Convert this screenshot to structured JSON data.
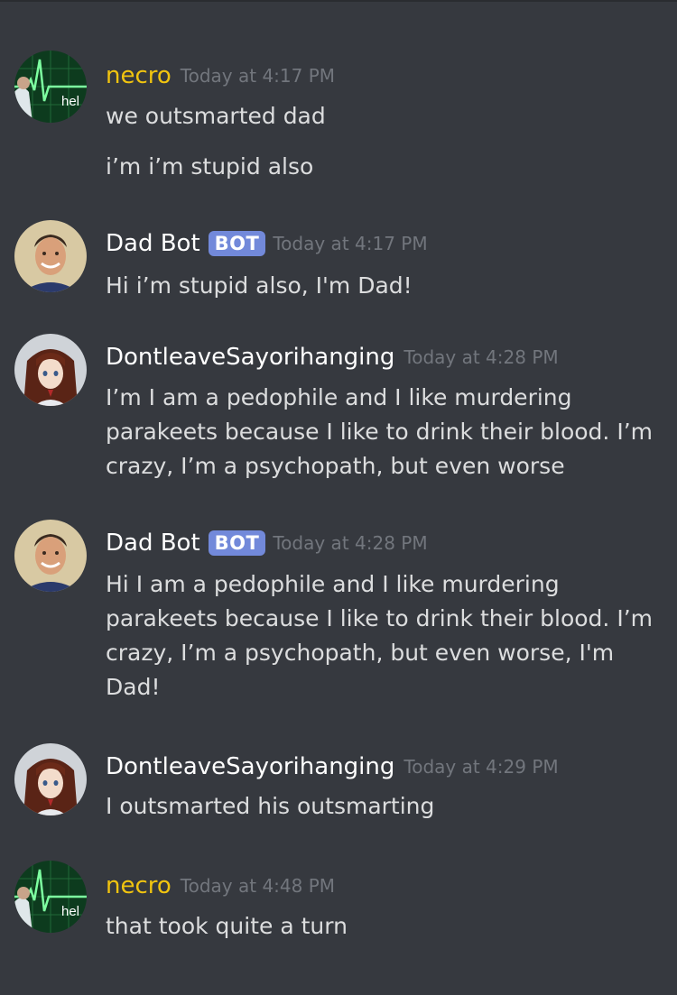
{
  "messages": [
    {
      "author": "necro",
      "author_color": "#f1c40f",
      "bot": false,
      "avatar_icon": "heartbeat-avatar-icon",
      "avatar_text": "hel",
      "timestamp": "Today at 4:17 PM",
      "lines": [
        "we outsmarted dad",
        "i’m i’m stupid also"
      ]
    },
    {
      "author": "Dad Bot",
      "author_color": "#ffffff",
      "bot": true,
      "badge": "BOT",
      "avatar_icon": "smiling-man-avatar-icon",
      "timestamp": "Today at 4:17 PM",
      "lines": [
        "Hi i’m stupid also, I'm Dad!"
      ]
    },
    {
      "author": "DontleaveSayorihanging",
      "author_color": "#ffffff",
      "bot": false,
      "avatar_icon": "anime-girl-avatar-icon",
      "timestamp": "Today at 4:28 PM",
      "lines": [
        "I’m I am a pedophile and I like murdering parakeets because I like to drink their blood. I’m crazy, I’m a psychopath, but even worse"
      ]
    },
    {
      "author": "Dad Bot",
      "author_color": "#ffffff",
      "bot": true,
      "badge": "BOT",
      "avatar_icon": "smiling-man-avatar-icon",
      "timestamp": "Today at 4:28 PM",
      "lines": [
        "Hi I am a pedophile and I like murdering parakeets because I like to drink their blood. I’m crazy, I’m a psychopath, but even worse, I'm Dad!"
      ]
    },
    {
      "author": "DontleaveSayorihanging",
      "author_color": "#ffffff",
      "bot": false,
      "avatar_icon": "anime-girl-avatar-icon",
      "timestamp": "Today at 4:29 PM",
      "lines": [
        "I outsmarted his outsmarting"
      ]
    },
    {
      "author": "necro",
      "author_color": "#f1c40f",
      "bot": false,
      "avatar_icon": "heartbeat-avatar-icon",
      "avatar_text": "hel",
      "timestamp": "Today at 4:48 PM",
      "lines": [
        "that took quite a turn"
      ]
    }
  ]
}
